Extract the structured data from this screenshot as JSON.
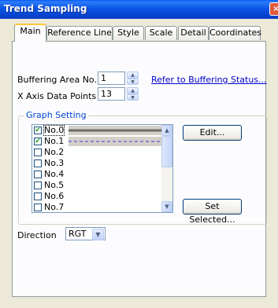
{
  "window": {
    "title": "Trend Sampling",
    "close_glyph": "×"
  },
  "tabs": [
    {
      "label": "Main",
      "active": true
    },
    {
      "label": "Reference Line"
    },
    {
      "label": "Style"
    },
    {
      "label": "Scale"
    },
    {
      "label": "Detail"
    },
    {
      "label": "Coordinates"
    }
  ],
  "main": {
    "buffering_area": {
      "label": "Buffering Area No.",
      "value": "1"
    },
    "refer_link": "Refer to Buffering Status...",
    "x_axis": {
      "label": "X Axis Data Points",
      "value": "13"
    },
    "graph_setting": {
      "title": "Graph Setting",
      "items": [
        {
          "label": "No.0",
          "checked": true,
          "line": "solid"
        },
        {
          "label": "No.1",
          "checked": true,
          "line": "dashed"
        },
        {
          "label": "No.2",
          "checked": false
        },
        {
          "label": "No.3",
          "checked": false
        },
        {
          "label": "No.4",
          "checked": false
        },
        {
          "label": "No.5",
          "checked": false
        },
        {
          "label": "No.6",
          "checked": false
        },
        {
          "label": "No.7",
          "checked": false
        }
      ],
      "edit_button": "Edit...",
      "set_selected_button": "Set Selected..."
    },
    "direction": {
      "label": "Direction",
      "value": "RGT"
    }
  },
  "colors": {
    "titlebar": "#0A5BF5",
    "link": "#0000CC",
    "group_title": "#0046D5",
    "line_series_0": "#6B6B6B",
    "line_series_1": "#3A3AE0"
  },
  "icons": {
    "check": "✔",
    "spin_up": "▲",
    "spin_down": "▼",
    "scroll_up": "▲",
    "scroll_down": "▼",
    "combo_arrow": "▼"
  }
}
